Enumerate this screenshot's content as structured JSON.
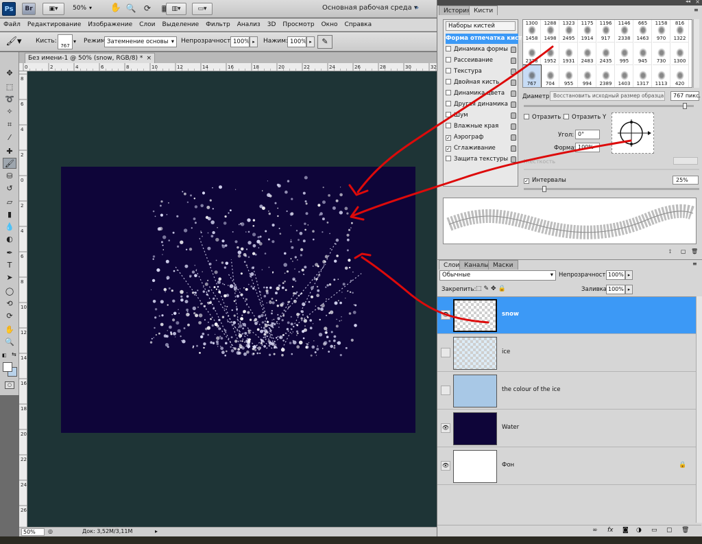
{
  "app": {
    "logo": "Ps",
    "bridge": "Br",
    "zoom_chip": "50%",
    "workspace": "Основная рабочая среда"
  },
  "menu": [
    "Файл",
    "Редактирование",
    "Изображение",
    "Слои",
    "Выделение",
    "Фильтр",
    "Анализ",
    "3D",
    "Просмотр",
    "Окно",
    "Справка"
  ],
  "options": {
    "brush_label": "Кисть:",
    "brush_size": "767",
    "mode_label": "Режим:",
    "mode_value": "Затемнение основы",
    "opacity_label": "Непрозрачность:",
    "opacity_value": "100%",
    "pressure_label": "Нажим:",
    "pressure_value": "100%"
  },
  "document": {
    "tab_title": "Без имени-1 @ 50% (snow, RGB/8) *",
    "ruler_h_labels": [
      "0",
      "2",
      "4",
      "6",
      "8",
      "10",
      "12",
      "14",
      "16",
      "18",
      "20",
      "22",
      "24",
      "26",
      "28",
      "30",
      "32"
    ],
    "ruler_v_labels": [
      "8",
      "6",
      "4",
      "2",
      "0",
      "2",
      "4",
      "6",
      "8",
      "10",
      "12",
      "14",
      "16",
      "18",
      "20",
      "22",
      "24",
      "26"
    ]
  },
  "status": {
    "zoom": "50%",
    "doc_info": "Док: 3,52M/3,11M"
  },
  "brush_panel": {
    "tabs": [
      "История",
      "Кисти"
    ],
    "presets_button": "Наборы кистей",
    "options": [
      {
        "label": "Форма отпечатка кисти",
        "checked": null,
        "selected": true
      },
      {
        "label": "Динамика формы",
        "checked": false
      },
      {
        "label": "Рассеивание",
        "checked": false
      },
      {
        "label": "Текстура",
        "checked": false
      },
      {
        "label": "Двойная кисть",
        "checked": false
      },
      {
        "label": "Динамика цвета",
        "checked": false
      },
      {
        "label": "Другая динамика",
        "checked": false
      },
      {
        "label": "Шум",
        "checked": false
      },
      {
        "label": "Влажные края",
        "checked": false
      },
      {
        "label": "Аэрограф",
        "checked": true
      },
      {
        "label": "Сглаживание",
        "checked": true
      },
      {
        "label": "Защита текстуры",
        "checked": false
      }
    ],
    "brush_tips": [
      {
        "top": "1300",
        "bottom": "1458"
      },
      {
        "top": "1288",
        "bottom": "1498"
      },
      {
        "top": "1323",
        "bottom": "2495"
      },
      {
        "top": "1175",
        "bottom": "1914"
      },
      {
        "top": "1196",
        "bottom": "917"
      },
      {
        "top": "1146",
        "bottom": "2338"
      },
      {
        "top": "665",
        "bottom": "1463"
      },
      {
        "top": "1158",
        "bottom": "970"
      },
      {
        "top": "816",
        "bottom": "1322"
      },
      {
        "top": "",
        "bottom": "2328"
      },
      {
        "top": "",
        "bottom": "1952"
      },
      {
        "top": "",
        "bottom": "1931"
      },
      {
        "top": "",
        "bottom": "2483"
      },
      {
        "top": "",
        "bottom": "2435"
      },
      {
        "top": "",
        "bottom": "995"
      },
      {
        "top": "",
        "bottom": "945"
      },
      {
        "top": "",
        "bottom": "730"
      },
      {
        "top": "",
        "bottom": "1300"
      },
      {
        "top": "",
        "bottom": "767"
      },
      {
        "top": "",
        "bottom": "704"
      },
      {
        "top": "",
        "bottom": "955"
      },
      {
        "top": "",
        "bottom": "994"
      },
      {
        "top": "",
        "bottom": "2389"
      },
      {
        "top": "",
        "bottom": "1403"
      },
      {
        "top": "",
        "bottom": "1317"
      },
      {
        "top": "",
        "bottom": "1113"
      },
      {
        "top": "",
        "bottom": "420"
      }
    ],
    "diameter_label": "Диаметр",
    "restore_button": "Восстановить исходный размер образца",
    "diameter_value": "767 пикс.",
    "flip_x": "Отразить X",
    "flip_y": "Отразить Y",
    "angle_label": "Угол:",
    "angle_value": "0°",
    "roundness_label": "Форма:",
    "roundness_value": "100%",
    "hardness_label": "Жесткость",
    "spacing_label": "Интервалы",
    "spacing_checked": true,
    "spacing_value": "25%"
  },
  "layers_panel": {
    "tabs": [
      "Слои",
      "Каналы",
      "Маски"
    ],
    "blend_mode": "Обычные",
    "opacity_label": "Непрозрачность:",
    "opacity_value": "100%",
    "lock_label": "Закрепить:",
    "fill_label": "Заливка:",
    "fill_value": "100%",
    "layers": [
      {
        "name": "snow",
        "visible": true,
        "selected": true,
        "thumb": "checker"
      },
      {
        "name": "ice",
        "visible": false,
        "selected": false,
        "thumb": "checker-blue"
      },
      {
        "name": "the colour of the ice",
        "visible": false,
        "selected": false,
        "thumb": "#a8c8e6"
      },
      {
        "name": "Water",
        "visible": true,
        "selected": false,
        "thumb": "#0e0539"
      },
      {
        "name": "Фон",
        "visible": true,
        "selected": false,
        "thumb": "#ffffff",
        "locked": true
      }
    ],
    "bottom_icons": [
      "link-icon",
      "fx-icon",
      "mask-icon",
      "adjustment-icon",
      "group-icon",
      "new-layer-icon",
      "trash-icon"
    ]
  },
  "colors": {
    "pasteboard": "#1e3436",
    "canvas": "#0e0539",
    "selection": "#3c99f6",
    "annotation": "#dd0a0a"
  }
}
